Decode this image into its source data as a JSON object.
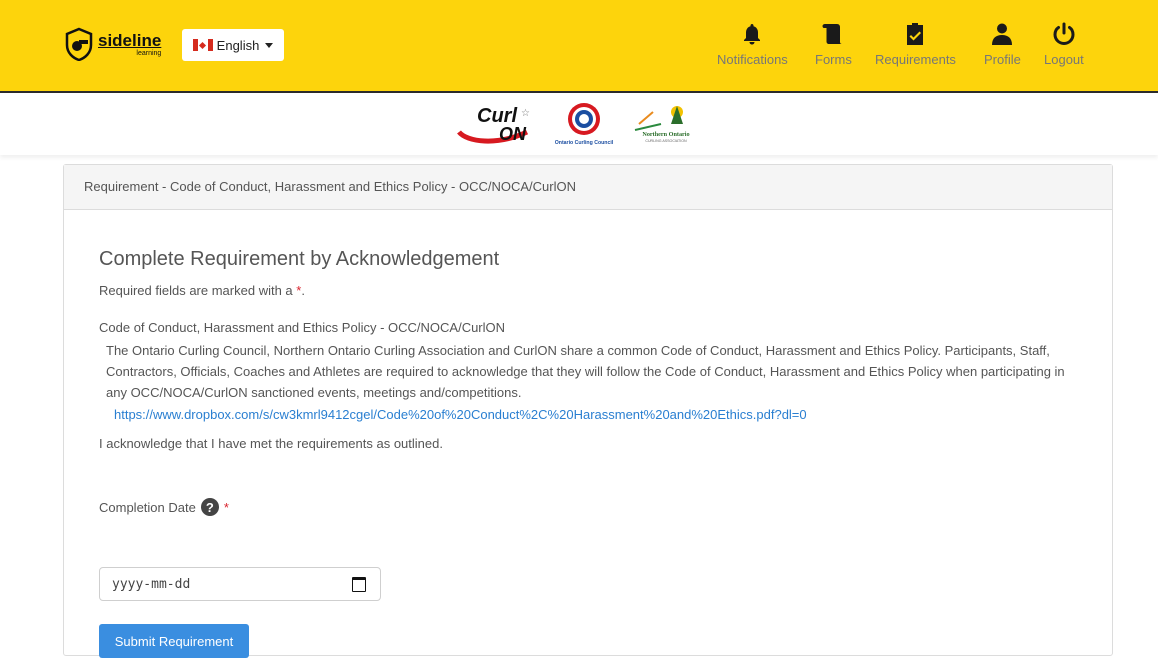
{
  "header": {
    "logo_main": "sideline",
    "logo_sub": "learning",
    "language_label": "English",
    "nav": [
      {
        "label": "Notifications",
        "icon": "bell-icon"
      },
      {
        "label": "Forms",
        "icon": "scroll-icon"
      },
      {
        "label": "Requirements",
        "icon": "clipboard-check-icon"
      },
      {
        "label": "Profile",
        "icon": "user-icon"
      },
      {
        "label": "Logout",
        "icon": "power-icon"
      }
    ]
  },
  "partners": {
    "curl_top": "Curl",
    "curl_bottom": "ON",
    "occ_name": "Ontario Curling Council",
    "noca_name": "Northern Ontario",
    "noca_sub": "CURLING ASSOCIATION"
  },
  "card": {
    "header": "Requirement - Code of Conduct, Harassment and Ethics Policy - OCC/NOCA/CurlON",
    "title": "Complete Requirement by Acknowledgement",
    "required_note": "Required fields are marked with a",
    "required_star": "*",
    "required_dot": ".",
    "policy_title": "Code of Conduct, Harassment and Ethics Policy - OCC/NOCA/CurlON",
    "policy_desc": "The Ontario Curling Council, Northern Ontario Curling Association and CurlON share a common Code of Conduct, Harassment and Ethics Policy. Participants, Staff, Contractors, Officials, Coaches and Athletes are required to acknowledge that they will follow the Code of Conduct, Harassment and Ethics Policy when participating in any OCC/NOCA/CurlON sanctioned events, meetings and/competitions.",
    "policy_link": "https://www.dropbox.com/s/cw3kmrl9412cgel/Code%20of%20Conduct%2C%20Harassment%20and%20Ethics.pdf?dl=0",
    "acknowledge": "I acknowledge that I have met the requirements as outlined.",
    "date_label": "Completion Date",
    "date_placeholder": "yyyy-mm-dd",
    "submit_label": "Submit Requirement"
  },
  "colors": {
    "topbar": "#fdd40c",
    "link": "#2a7fd1",
    "button": "#3a8ee0",
    "required": "#d9232d"
  }
}
